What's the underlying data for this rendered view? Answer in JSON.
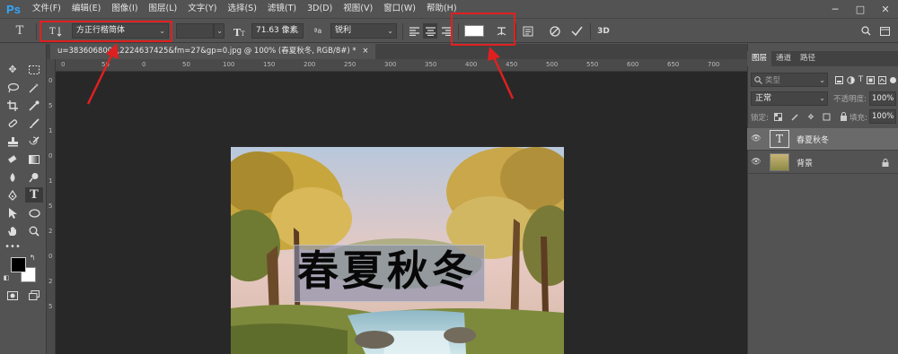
{
  "app": {
    "logo": "Ps"
  },
  "menu": [
    "文件(F)",
    "编辑(E)",
    "图像(I)",
    "图层(L)",
    "文字(Y)",
    "选择(S)",
    "滤镜(T)",
    "3D(D)",
    "视图(V)",
    "窗口(W)",
    "帮助(H)"
  ],
  "window_controls": {
    "minimize": "─",
    "maximize": "□",
    "close": "✕"
  },
  "options": {
    "font_family": "方正行楷简体",
    "font_size": "71.63 像素",
    "antialias_icon_text": "ªa",
    "antialias": "锐利",
    "color_swatch": "#ffffff",
    "three_d": "3D"
  },
  "document": {
    "tab_title": "u=3836068000,2224637425&fm=27&gp=0.jpg @ 100% (春夏秋冬, RGB/8#) *",
    "tab_close": "×",
    "art_text": "春夏秋冬",
    "ruler_top": [
      "0",
      "50",
      "0",
      "50",
      "100",
      "150",
      "200",
      "250",
      "300",
      "350",
      "400",
      "450",
      "500",
      "550",
      "600",
      "650",
      "700"
    ],
    "ruler_left": [
      "0",
      "5",
      "1",
      "0",
      "1",
      "5",
      "2",
      "0",
      "2",
      "5"
    ]
  },
  "panel": {
    "tabs": [
      "图层",
      "通道",
      "路径"
    ],
    "search_placeholder": "类型",
    "blend_mode": "正常",
    "opacity_label": "不透明度:",
    "opacity_value": "100%",
    "lock_label": "锁定:",
    "fill_label": "填充:",
    "fill_value": "100%",
    "layers": [
      {
        "name": "春夏秋冬",
        "type": "text",
        "selected": true
      },
      {
        "name": "背景",
        "type": "image",
        "selected": false,
        "locked": true
      }
    ]
  },
  "colors": {
    "accent_red": "#e02020",
    "ps_blue": "#31a8ff"
  }
}
